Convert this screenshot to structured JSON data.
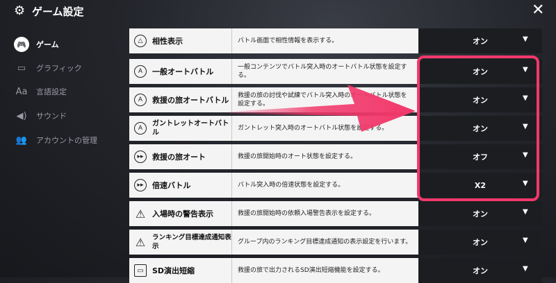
{
  "window": {
    "title": "ゲーム設定",
    "title_icon": "gear-icon",
    "close_icon": "close-icon"
  },
  "sidebar": {
    "items": [
      {
        "label": "ゲーム",
        "icon": "gamepad-icon",
        "active": true
      },
      {
        "label": "グラフィック",
        "icon": "monitor-icon",
        "active": false
      },
      {
        "label": "言語設定",
        "icon": "language-icon",
        "active": false
      },
      {
        "label": "サウンド",
        "icon": "speaker-icon",
        "active": false
      },
      {
        "label": "アカウントの管理",
        "icon": "account-icon",
        "active": false
      }
    ]
  },
  "settings": [
    {
      "label": "相性表示",
      "icon": "affinity-icon",
      "description": "バトル画面で相性情報を表示する。",
      "value": "オン"
    },
    {
      "label": "一般オートバトル",
      "icon": "auto-battle-icon",
      "description": "一般コンテンツでバトル突入時のオートバトル状態を設定する。",
      "value": "オン"
    },
    {
      "label": "救援の旅オートバトル",
      "icon": "auto-battle-icon",
      "description": "救援の旅の討伐や試練でバトル突入時のオートバトル状態を設定する。",
      "value": "オン"
    },
    {
      "label": "ガントレットオートバトル",
      "icon": "auto-battle-icon",
      "description": "ガントレット突入時のオートバトル状態を設定する。",
      "value": "オン"
    },
    {
      "label": "救援の旅オート",
      "icon": "fast-forward-icon",
      "description": "救援の旅開始時のオート状態を設定する。",
      "value": "オフ"
    },
    {
      "label": "倍速バトル",
      "icon": "fast-forward-icon",
      "description": "バトル突入時の倍速状態を設定する。",
      "value": "X2"
    },
    {
      "label": "入場時の警告表示",
      "icon": "warning-icon",
      "description": "救援の旅開始時の依頼入場警告表示を設定する。",
      "value": "オン"
    },
    {
      "label": "ランキング目標達成通知表示",
      "icon": "warning-icon",
      "description": "グループ内のランキング目標達成通知の表示設定を行います。",
      "value": "オン"
    },
    {
      "label": "SD演出短縮",
      "icon": "monitor-icon",
      "description": "救援の旅で出力されるSD演出短縮機能を設定する。",
      "value": "オン"
    }
  ],
  "annotation": {
    "color": "#f2386b"
  }
}
